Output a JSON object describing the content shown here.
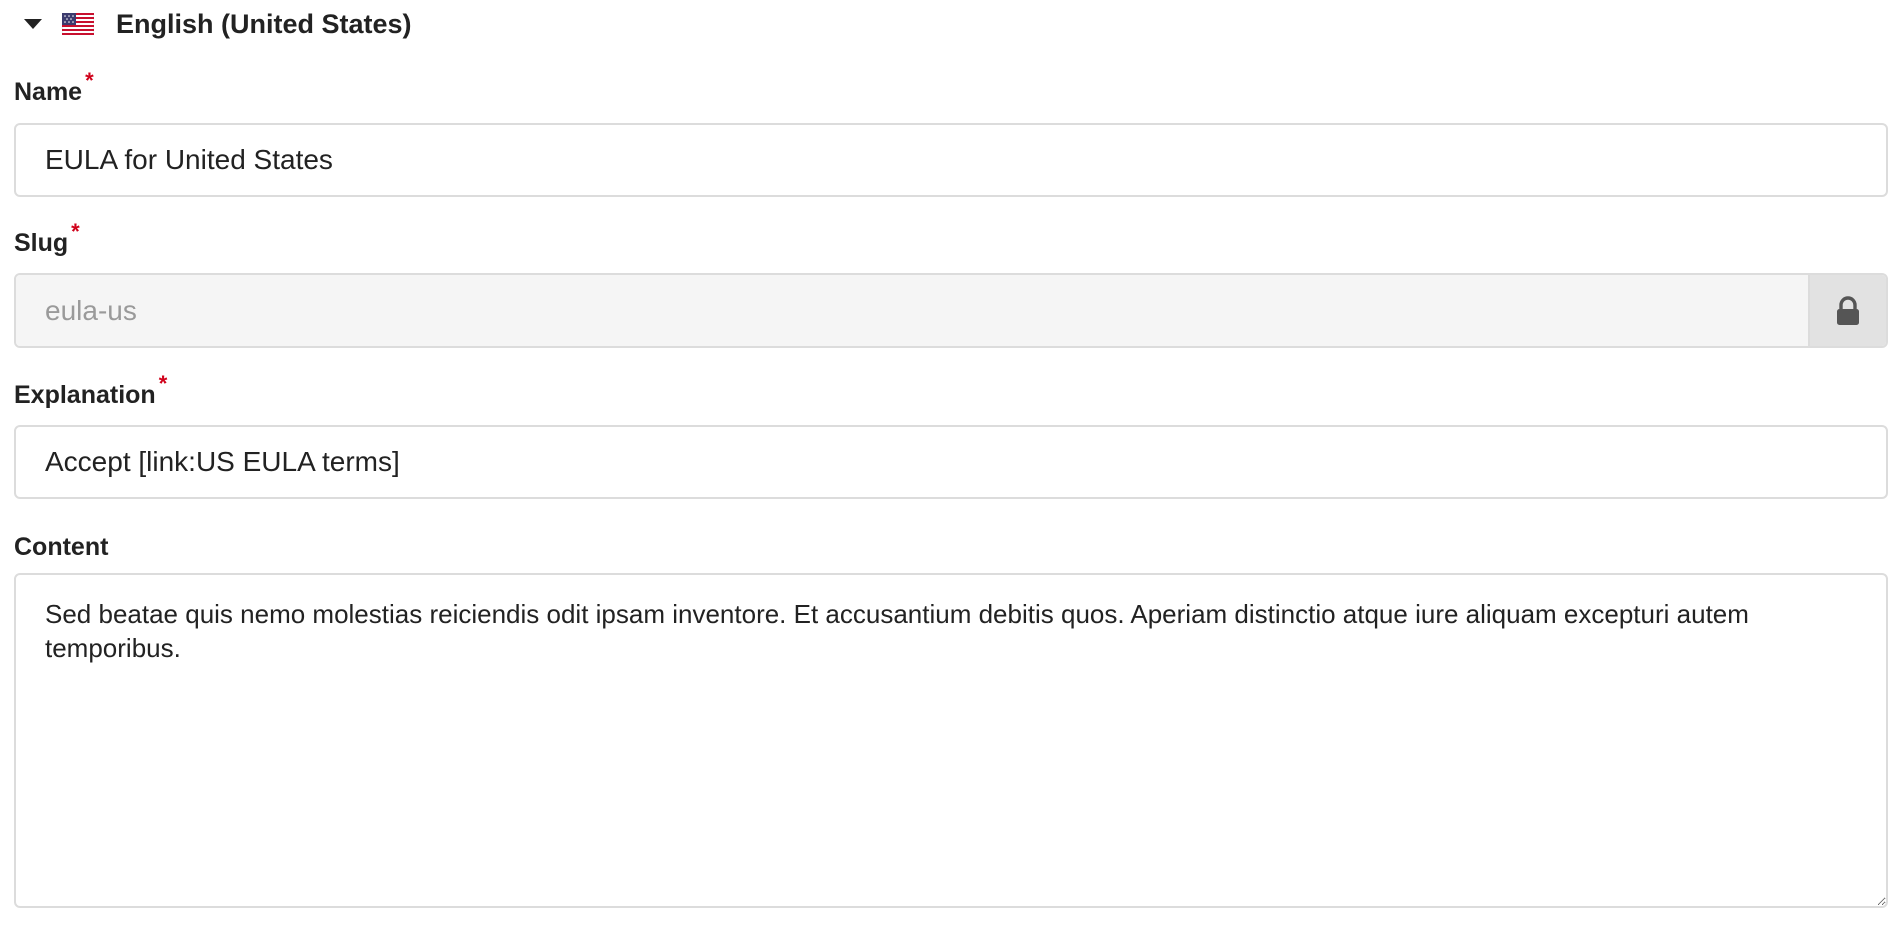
{
  "locale": {
    "title": "English (United States)",
    "expanded": true,
    "flag_icon": "us-flag-icon"
  },
  "fields": {
    "name": {
      "label": "Name",
      "required": true,
      "value": "EULA for United States"
    },
    "slug": {
      "label": "Slug",
      "required": true,
      "value": "eula-us",
      "locked": true,
      "lock_icon": "lock-icon"
    },
    "explanation": {
      "label": "Explanation",
      "required": true,
      "value": "Accept [link:US EULA terms]"
    },
    "content": {
      "label": "Content",
      "required": false,
      "value": "Sed beatae quis nemo molestias reiciendis odit ipsam inventore. Et accusantium debitis quos. Aperiam distinctio atque iure aliquam excepturi autem temporibus."
    }
  },
  "required_marker": "*",
  "colors": {
    "required": "#d0021b",
    "border": "#dcdcdc",
    "locked_bg": "#f5f5f5",
    "lock_button_bg": "#e2e2e2"
  }
}
